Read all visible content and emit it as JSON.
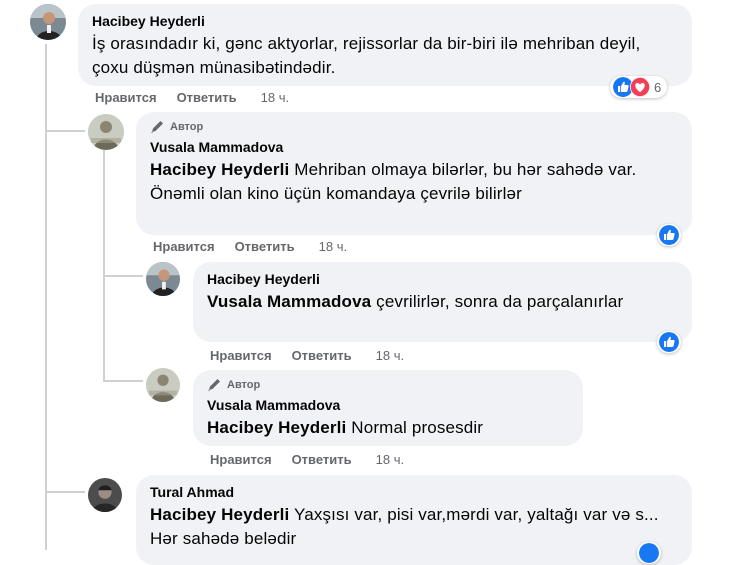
{
  "colors": {
    "like_blue": "#1877f2",
    "love_red": "#f33e58",
    "bubble": "#f0f2f5",
    "meta": "#65676b"
  },
  "labels": {
    "like": "Нравится",
    "reply": "Ответить",
    "author_badge": "Автор"
  },
  "comments": [
    {
      "author": "Hacibey Heyderli",
      "mention": "",
      "text": "İş orasındadır ki, gənc aktyorlar, rejissorlar da bir-biri ilə mehriban deyil, çoxu düşmən münasibətindədir.",
      "time": "18 ч.",
      "reactions": {
        "icons": [
          "like-icon",
          "love-icon"
        ],
        "count": "6"
      }
    },
    {
      "author": "Vusala Mammadova",
      "is_author": true,
      "mention": "Hacibey Heyderli",
      "text": "Mehriban olmaya bilərlər, bu hər sahədə var. Önəmli olan kino üçün komandaya çevrilə bilirlər",
      "time": "18 ч.",
      "reactions": {
        "icons": [
          "like-icon"
        ],
        "count": ""
      }
    },
    {
      "author": "Hacibey Heyderli",
      "mention": "Vusala Mammadova",
      "text": "çevrilirlər, sonra da parçalanırlar",
      "time": "18 ч.",
      "reactions": {
        "icons": [
          "like-icon"
        ],
        "count": ""
      }
    },
    {
      "author": "Vusala Mammadova",
      "is_author": true,
      "mention": "Hacibey Heyderli",
      "text": "Normal prosesdir",
      "time": "18 ч."
    },
    {
      "author": "Tural Ahmad",
      "mention": "Hacibey Heyderli",
      "text": "Yaxşısı var, pisi var,mərdi var, yaltağı var və s... Hər sahədə belədir"
    }
  ]
}
